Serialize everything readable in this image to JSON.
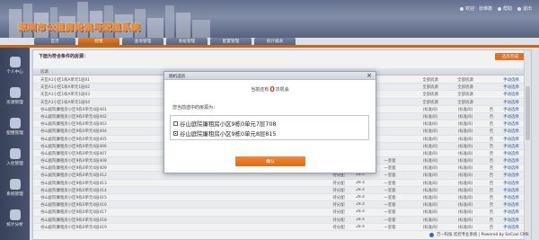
{
  "header": {
    "system_title": "深圳市公租房轮候与配租系统",
    "user_info": "欢迎：张维康",
    "help": "帮助",
    "logout": "退出"
  },
  "nav": {
    "tabs": [
      {
        "label": "首页"
      },
      {
        "label": "配租"
      },
      {
        "label": "查询管理"
      },
      {
        "label": "系统管理"
      },
      {
        "label": "配置管理"
      },
      {
        "label": "统计报表"
      }
    ],
    "active_index": 1
  },
  "sidebar": {
    "items": [
      {
        "label": "个人中心"
      },
      {
        "label": "房源管理"
      },
      {
        "label": "配租管理"
      },
      {
        "label": "入住管理"
      },
      {
        "label": "系统管理"
      },
      {
        "label": "统计分析"
      }
    ]
  },
  "main": {
    "title": "下面为符合条件的房源：",
    "action_label": "选房完成",
    "table_header": {
      "name": "房源"
    },
    "rows": [
      {
        "name": "天瓦A1小区1栋A单元1层01",
        "area": "",
        "price": "",
        "floor": "",
        "type": "全部房源",
        "struct": "全部房源",
        "yes": "",
        "op": "手动选择"
      },
      {
        "name": "天瓦A1小区1栋A单元1层02",
        "area": "",
        "price": "",
        "floor": "",
        "type": "全部房源",
        "struct": "全部房源",
        "yes": "",
        "op": "手动选择"
      },
      {
        "name": "天瓦A1小区1栋A单元1层03",
        "area": "",
        "price": "",
        "floor": "",
        "type": "全部房源",
        "struct": "全部房源",
        "yes": "",
        "op": "手动选择"
      },
      {
        "name": "天瓦A1小区1栋A单元1层04",
        "area": "",
        "price": "",
        "floor": "",
        "type": "全部房源",
        "struct": "全部房源",
        "yes": "",
        "op": "手动选择"
      },
      {
        "name": "谷山庭院廉租房小区9栋0单元4层401",
        "area": "",
        "price": "",
        "floor": "",
        "type": "(标准间)",
        "struct": "(标准间)",
        "yes": "否",
        "op": "手动选择"
      },
      {
        "name": "谷山庭院廉租房小区9栋0单元4层402",
        "area": "",
        "price": "",
        "floor": "",
        "type": "(标准间)",
        "struct": "(标准间)",
        "yes": "否",
        "op": "手动选择"
      },
      {
        "name": "谷山庭院廉租房小区9栋0单元4层403",
        "area": "",
        "price": "",
        "floor": "",
        "type": "(标准间)",
        "struct": "(标准间)",
        "yes": "否",
        "op": "手动选择"
      },
      {
        "name": "谷山庭院廉租房小区9栋0单元4层404",
        "area": "",
        "price": "",
        "floor": "",
        "type": "(标准间)",
        "struct": "(标准间)",
        "yes": "否",
        "op": "手动选择"
      },
      {
        "name": "谷山庭院廉租房小区9栋0单元4层405",
        "area": "",
        "price": "",
        "floor": "",
        "type": "(标准间)",
        "struct": "(标准间)",
        "yes": "否",
        "op": "手动选择"
      },
      {
        "name": "谷山庭院廉租房小区9栋0单元4层406",
        "area": "",
        "price": "",
        "floor": "",
        "type": "(标准间)",
        "struct": "(标准间)",
        "yes": "否",
        "op": "手动选择"
      },
      {
        "name": "谷山庭院廉租房小区9栋0单元4层407",
        "area": "",
        "price": "",
        "floor": "",
        "type": "(标准间)",
        "struct": "(标准间)",
        "yes": "否",
        "op": "手动选择"
      },
      {
        "name": "谷山庭院廉租房小区9栋0单元4层408",
        "area": "46.84",
        "price": "",
        "floor": "一室套",
        "type": "(标准间)",
        "struct": "(标准间)",
        "yes": "否",
        "op": "手动选择"
      },
      {
        "name": "谷山庭院廉租房小区9栋0单元4层409",
        "area": "46.84",
        "price": "",
        "floor": "一室套",
        "type": "(标准间)",
        "struct": "(标准间)",
        "yes": "否",
        "op": "手动选择"
      },
      {
        "name": "谷山庭院廉租房小区9栋0单元4层412",
        "area": "待分配",
        "price": "28.4",
        "floor": "一室套",
        "type": "(标准间)",
        "struct": "(标准间)",
        "yes": "否",
        "op": "手动选择"
      },
      {
        "name": "谷山庭院廉租房小区9栋0单元4层413",
        "area": "待分配",
        "price": "28.4",
        "floor": "一室套",
        "type": "(标准间)",
        "struct": "(标准间)",
        "yes": "否",
        "op": "手动选择"
      },
      {
        "name": "谷山庭院廉租房小区9栋0单元4层414",
        "area": "待分配",
        "price": "28.4",
        "floor": "一室套",
        "type": "(标准间)",
        "struct": "(标准间)",
        "yes": "否",
        "op": "手动选择"
      },
      {
        "name": "谷山庭院廉租房小区9栋0单元4层415",
        "area": "待分配",
        "price": "28.4",
        "floor": "一室套",
        "type": "(标准间)",
        "struct": "(标准间)",
        "yes": "否",
        "op": "手动选择"
      },
      {
        "name": "谷山庭院廉租房小区9栋0单元4层416",
        "area": "待分配",
        "price": "28.4",
        "floor": "一室套",
        "type": "(标准间)",
        "struct": "(标准间)",
        "yes": "否",
        "op": "手动选择"
      },
      {
        "name": "谷山庭院廉租房小区9栋0单元4层417",
        "area": "待分配",
        "price": "28.4",
        "floor": "一室套",
        "type": "(标准间)",
        "struct": "(标准间)",
        "yes": "否",
        "op": "手动选择"
      },
      {
        "name": "谷山庭院廉租房小区9栋0单元4层418",
        "area": "待分配",
        "price": "28.4",
        "floor": "一室套",
        "type": "(标准间)",
        "struct": "(标准间)",
        "yes": "否",
        "op": "手动选择"
      },
      {
        "name": "谷山庭院廉租房小区9栋0单元4层419",
        "area": "待分配",
        "price": "28.4",
        "floor": "一室套",
        "type": "(标准间)",
        "struct": "(标准间)",
        "yes": "否",
        "op": "手动选择"
      }
    ]
  },
  "footer": {
    "text": "万一科技·宏控专业系统 | Powered by SeCool CMS"
  },
  "modal": {
    "title": "随机选房",
    "chance_prefix": "当前还有",
    "chance_count": "0",
    "chance_suffix": "次机会",
    "selected_label": "您当前选中的房源为：",
    "choices": [
      {
        "label": "谷山庭院廉租房小区9栋0单元7层708",
        "checked": false
      },
      {
        "label": "谷山庭院廉租房小区9栋0单元8层815",
        "checked": true
      }
    ],
    "confirm_label": "确认"
  },
  "colors": {
    "accent": "#e97b25",
    "header": "#6a7797",
    "sidebar": "#3c4660",
    "highlight_number": "#e3362a"
  }
}
